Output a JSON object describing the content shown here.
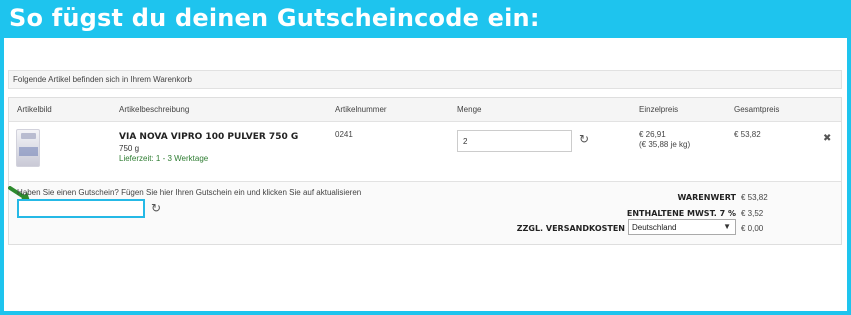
{
  "banner": {
    "title": "So fügst du deinen Gutscheincode ein:"
  },
  "info_bar": {
    "text": "Folgende Artikel befinden sich in Ihrem Warenkorb"
  },
  "table": {
    "headers": {
      "image": "Artikelbild",
      "description": "Artikelbeschreibung",
      "number": "Artikelnummer",
      "quantity": "Menge",
      "unit_price": "Einzelpreis",
      "total_price": "Gesamtpreis"
    },
    "rows": [
      {
        "name": "VIA NOVA VIPRO 100 PULVER 750 G",
        "size": "750 g",
        "delivery": "Lieferzeit: 1 - 3 Werktage",
        "article_number": "0241",
        "quantity": "2",
        "unit_price": "€ 26,91",
        "unit_price_per_kg": "(€ 35,88 je kg)",
        "total_price": "€ 53,82",
        "refresh_icon": "refresh-icon",
        "remove_icon": "close-icon"
      }
    ]
  },
  "coupon": {
    "label": "Haben Sie einen Gutschein? Fügen Sie hier Ihren Gutschein ein und klicken Sie auf aktualisieren",
    "value": "",
    "refresh_icon": "refresh-icon",
    "pointer_icon": "arrow-icon"
  },
  "summary": {
    "goods_label": "WARENWERT",
    "goods_value": "€ 53,82",
    "vat_label": "ENTHALTENE MWST. 7 %",
    "vat_value": "€ 3,52",
    "shipping_label": "ZZGL. VERSANDKOSTEN",
    "shipping_country": "Deutschland",
    "shipping_value": "€ 0,00"
  },
  "colors": {
    "banner": "#1ec4ee",
    "banner_text": "#ffffff",
    "delivery_text": "#2e7d32",
    "coupon_border": "#25b9e6",
    "arrow": "#2e8b2e"
  }
}
